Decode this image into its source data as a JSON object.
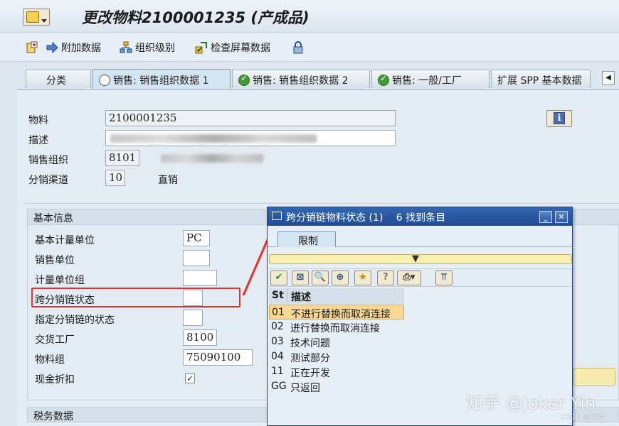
{
  "window": {
    "title": "更改物料2100001235 (产成品)"
  },
  "toolbar": {
    "items": [
      {
        "label": "附加数据",
        "icon": "arrow-right-icon"
      },
      {
        "label": "组织级别",
        "icon": "org-hierarchy-icon"
      },
      {
        "label": "检查屏幕数据",
        "icon": "check-screen-icon"
      }
    ]
  },
  "tabs": [
    {
      "label": "分类"
    },
    {
      "label": "销售: 销售组织数据 1"
    },
    {
      "label": "销售: 销售组织数据 2"
    },
    {
      "label": "销售: 一般/工厂"
    },
    {
      "label": "扩展 SPP 基本数据"
    }
  ],
  "header": {
    "material_label": "物料",
    "material_value": "2100001235",
    "desc_label": "描述",
    "sales_org_label": "销售组织",
    "sales_org_value": "8101",
    "dist_channel_label": "分销渠道",
    "dist_channel_value": "10",
    "dist_channel_text": "直销"
  },
  "basic": {
    "title": "基本信息",
    "fields": [
      {
        "label": "基本计量单位",
        "value": "PC"
      },
      {
        "label": "销售单位",
        "value": ""
      },
      {
        "label": "计量单位组",
        "value": ""
      },
      {
        "label": "跨分销链状态",
        "value": ""
      },
      {
        "label": "指定分销链的状态",
        "value": ""
      },
      {
        "label": "交货工厂",
        "value": "8100"
      },
      {
        "label": "物料组",
        "value": "75090100"
      },
      {
        "label": "现金折扣",
        "value": "✓"
      }
    ]
  },
  "tax": {
    "title": "税务数据"
  },
  "popup": {
    "title": "跨分销链物料状态 (1)",
    "hits": "6 找到条目",
    "tab": "限制",
    "col_code": "St",
    "col_desc": "描述",
    "rows": [
      {
        "code": "01",
        "desc": "不进行替换而取消连接"
      },
      {
        "code": "02",
        "desc": "进行替换而取消连接"
      },
      {
        "code": "03",
        "desc": "技术问题"
      },
      {
        "code": "04",
        "desc": "测试部分"
      },
      {
        "code": "11",
        "desc": "正在开发"
      },
      {
        "code": "GG",
        "desc": "只返回"
      }
    ]
  },
  "watermark": {
    "main": "知乎 @Joker Yin",
    "sub": "CSDN @艾吆"
  },
  "colors": {
    "highlight": "#e8302c",
    "popup_title": "#1f4c94",
    "selected_row": "#f9d894"
  }
}
